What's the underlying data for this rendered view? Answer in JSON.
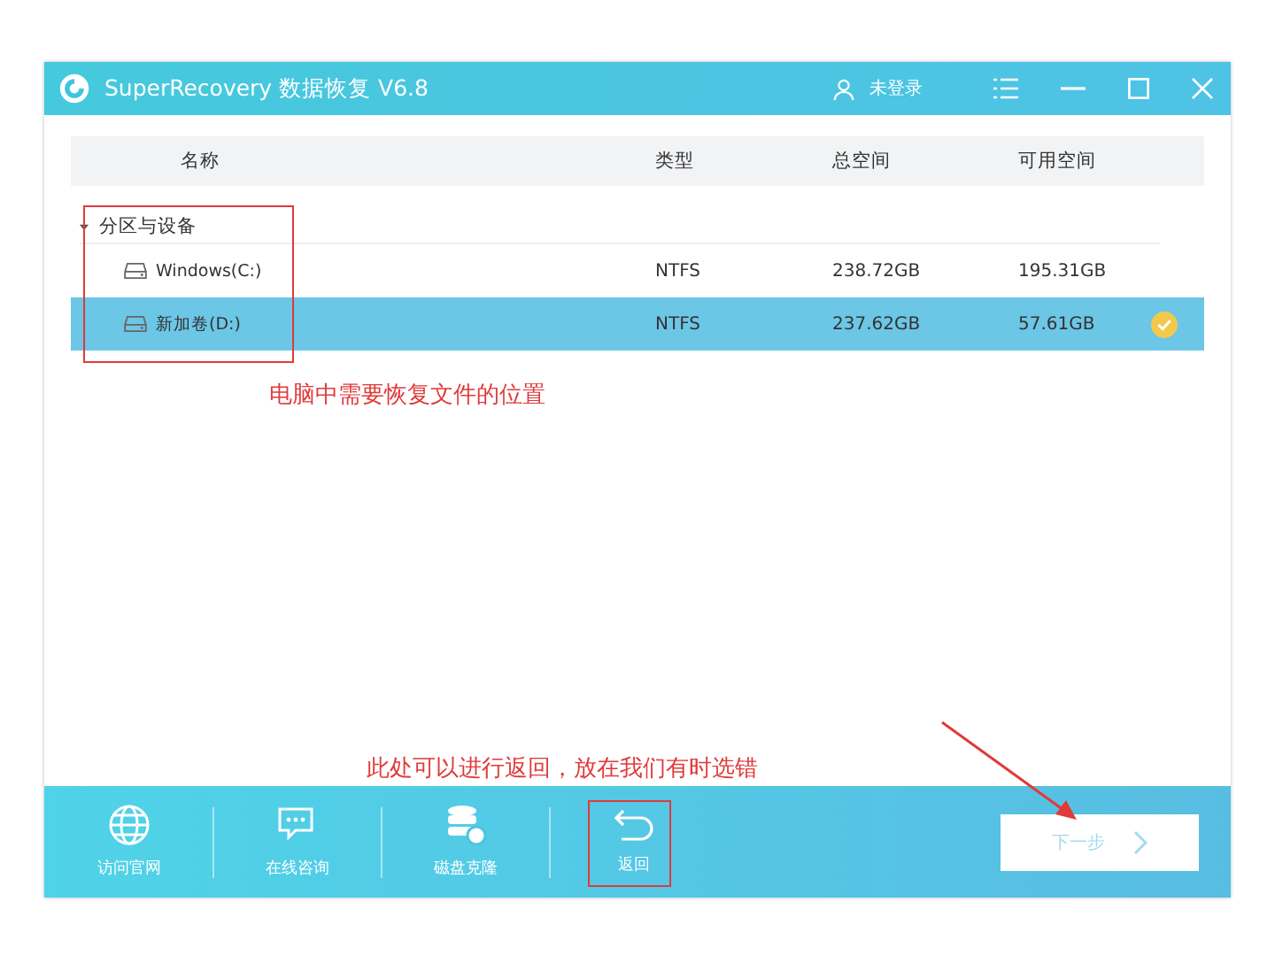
{
  "window": {
    "title": "SuperRecovery 数据恢复 V6.8",
    "user": "未登录"
  },
  "table": {
    "columns": [
      "名称",
      "类型",
      "总空间",
      "可用空间"
    ],
    "group": {
      "label": "分区与设备",
      "expanded": true
    },
    "rows": [
      {
        "name": "Windows(C:)",
        "type": "NTFS",
        "total": "238.72GB",
        "free": "195.31GB",
        "selected": false
      },
      {
        "name": "新加卷(D:)",
        "type": "NTFS",
        "total": "237.62GB",
        "free": "57.61GB",
        "selected": true
      }
    ]
  },
  "toolbar": [
    {
      "label": "访问官网",
      "kind": "globe"
    },
    {
      "label": "在线咨询",
      "kind": "chat"
    },
    {
      "label": "磁盘克隆",
      "kind": "disk"
    },
    {
      "label": "返回",
      "kind": "back"
    }
  ],
  "next_button": {
    "label": "下一步",
    "disabled": true
  },
  "annotations": [
    {
      "kind": "box"
    },
    {
      "kind": "text",
      "text": "电脑中需要恢复文件的位置"
    },
    {
      "kind": "text",
      "text": "此处可以进行返回，放在我们有时选错"
    },
    {
      "kind": "box"
    },
    {
      "kind": "arrow"
    }
  ]
}
